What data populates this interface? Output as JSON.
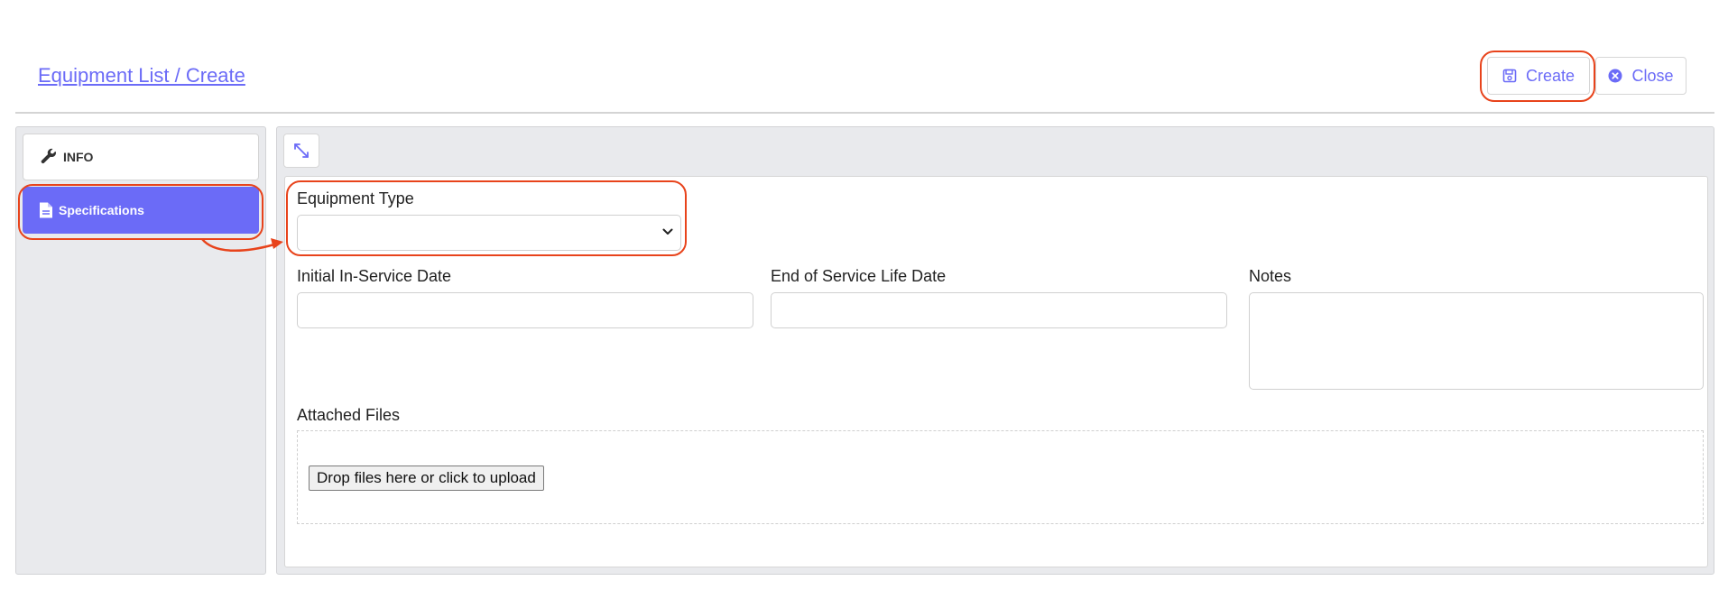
{
  "header": {
    "breadcrumb": "Equipment List / Create",
    "create_label": "Create",
    "close_label": "Close"
  },
  "sidebar": {
    "items": [
      {
        "label": "INFO",
        "icon": "wrench-icon",
        "active": false
      },
      {
        "label": "Specifications",
        "icon": "document-icon",
        "active": true
      }
    ]
  },
  "form": {
    "equipment_type": {
      "label": "Equipment Type",
      "value": ""
    },
    "initial_date": {
      "label": "Initial In-Service Date",
      "value": ""
    },
    "end_date": {
      "label": "End of Service Life Date",
      "value": ""
    },
    "notes": {
      "label": "Notes",
      "value": ""
    },
    "attached_files": {
      "label": "Attached Files",
      "upload_label": "Drop files here or click to upload"
    }
  },
  "colors": {
    "accent": "#6b6bf7",
    "highlight": "#e8431b",
    "panel_bg": "#e9eaed"
  }
}
